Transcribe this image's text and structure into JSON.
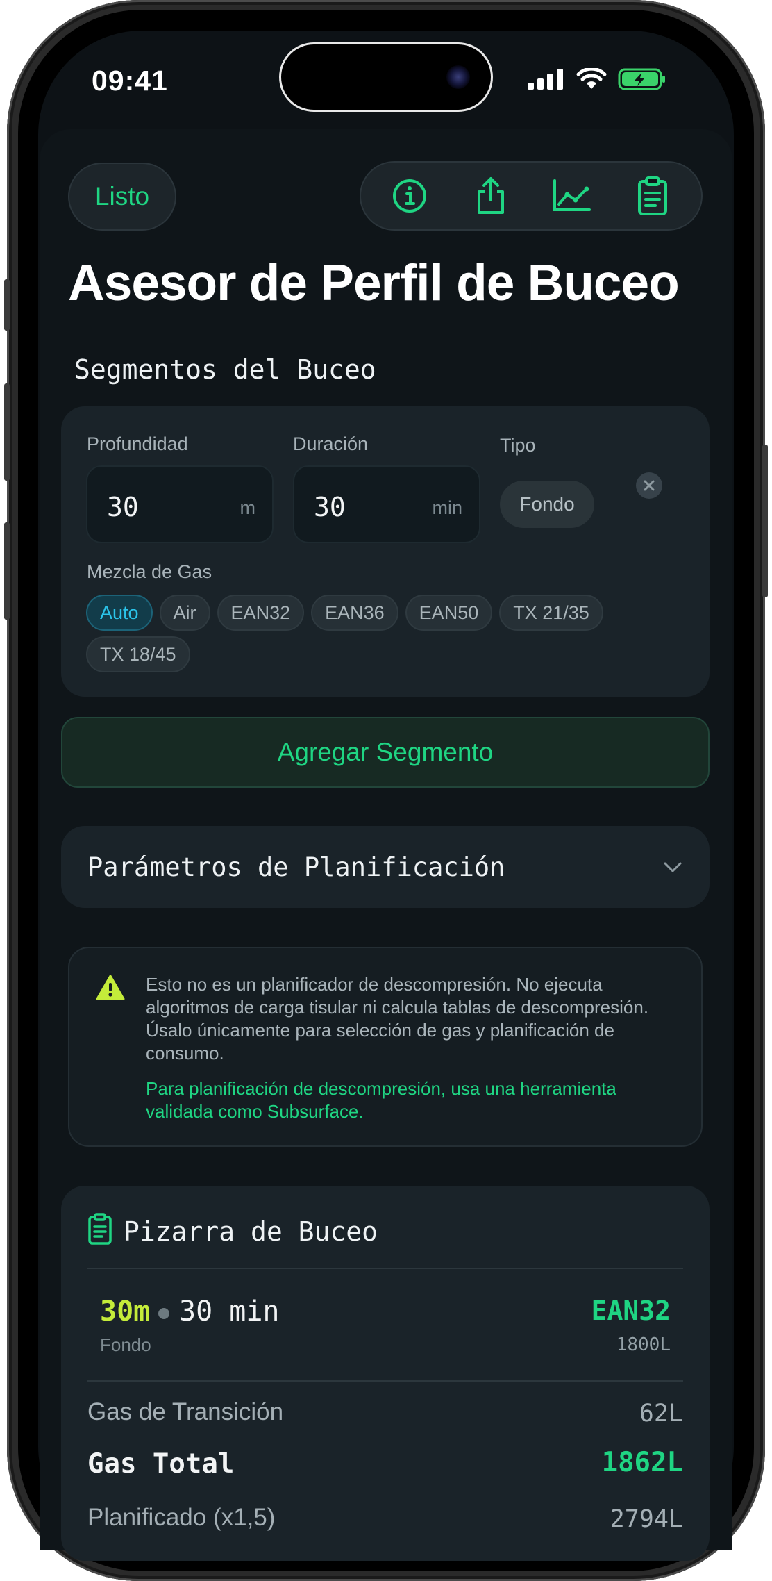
{
  "status": {
    "time": "09:41"
  },
  "toolbar": {
    "done_label": "Listo",
    "icons": [
      "info-icon",
      "share-icon",
      "chart-icon",
      "clipboard-icon"
    ]
  },
  "title": "Asesor de Perfil de Buceo",
  "segments_section": "Segmentos del Buceo",
  "segment": {
    "depth_label": "Profundidad",
    "depth_value": "30",
    "depth_unit": "m",
    "duration_label": "Duración",
    "duration_value": "30",
    "duration_unit": "min",
    "type_label": "Tipo",
    "type_value": "Fondo",
    "gas_label": "Mezcla de Gas",
    "gas_options": [
      "Auto",
      "Air",
      "EAN32",
      "EAN36",
      "EAN50",
      "TX 21/35",
      "TX 18/45"
    ],
    "gas_selected": "Auto"
  },
  "add_segment_label": "Agregar Segmento",
  "planning_params_label": "Parámetros de Planificación",
  "warning": {
    "text": "Esto no es un planificador de descompresión. No ejecuta algoritmos de carga tisular ni calcula tablas de descompresión. Úsalo únicamente para selección de gas y planificación de consumo.",
    "link_text": "Para planificación de descompresión, usa una herramienta validada como Subsurface."
  },
  "slate": {
    "title": "Pizarra de Buceo",
    "segment": {
      "depth": "30m",
      "duration": "30 min",
      "type": "Fondo",
      "gas": "EAN32",
      "volume": "1800L"
    },
    "transition_label": "Gas de Transición",
    "transition_value": "62L",
    "total_label": "Gas Total",
    "total_value": "1862L",
    "planned_label": "Planificado (x1,5)",
    "planned_value": "2794L"
  },
  "colors": {
    "accent_green": "#1fd583",
    "depth_yellow": "#c4ec3a",
    "selected_cyan": "#2bc4ea",
    "warning_yellow": "#c4ec3a",
    "background": "#0f1519"
  }
}
